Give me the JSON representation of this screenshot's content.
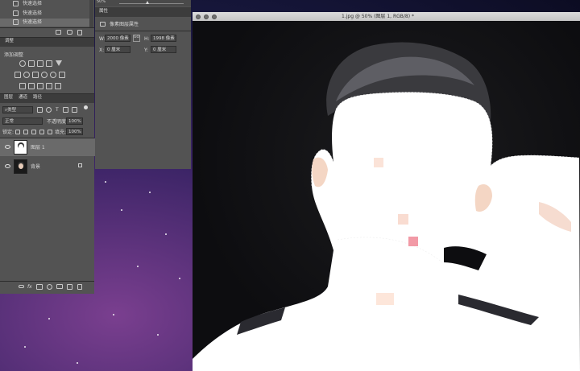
{
  "history": {
    "items": [
      "快速选择",
      "快速选择",
      "快速选择"
    ]
  },
  "adjustments": {
    "tab": "调整",
    "add_label": "添加调整"
  },
  "properties": {
    "tab": "属性",
    "title": "像素图层属性",
    "w_label": "W:",
    "w_value": "2000 像素",
    "h_label": "H:",
    "h_value": "1998 像素",
    "x_label": "X:",
    "x_value": "0 厘米",
    "y_label": "Y:",
    "y_value": "0 厘米",
    "link_label": "GO",
    "zoom_top": "50%"
  },
  "layers": {
    "tabs": [
      "图层",
      "通道",
      "路径"
    ],
    "filter_kind": "类型",
    "blend_mode": "正常",
    "opacity_label": "不透明度:",
    "opacity_value": "100%",
    "lock_label": "锁定:",
    "fill_label": "填充:",
    "fill_value": "100%",
    "rows": [
      {
        "name": "图层 1"
      },
      {
        "name": "背景"
      }
    ],
    "footer_fx": "fx"
  },
  "document": {
    "title": "1.jpg @ 50% (图层 1, RGB/8) *"
  },
  "colors": {
    "panel": "#535353",
    "panel_dark": "#3c3c3c",
    "selected_row": "#6a6a6a",
    "canvas_bg": "#111111",
    "mask": "#ffffff"
  }
}
